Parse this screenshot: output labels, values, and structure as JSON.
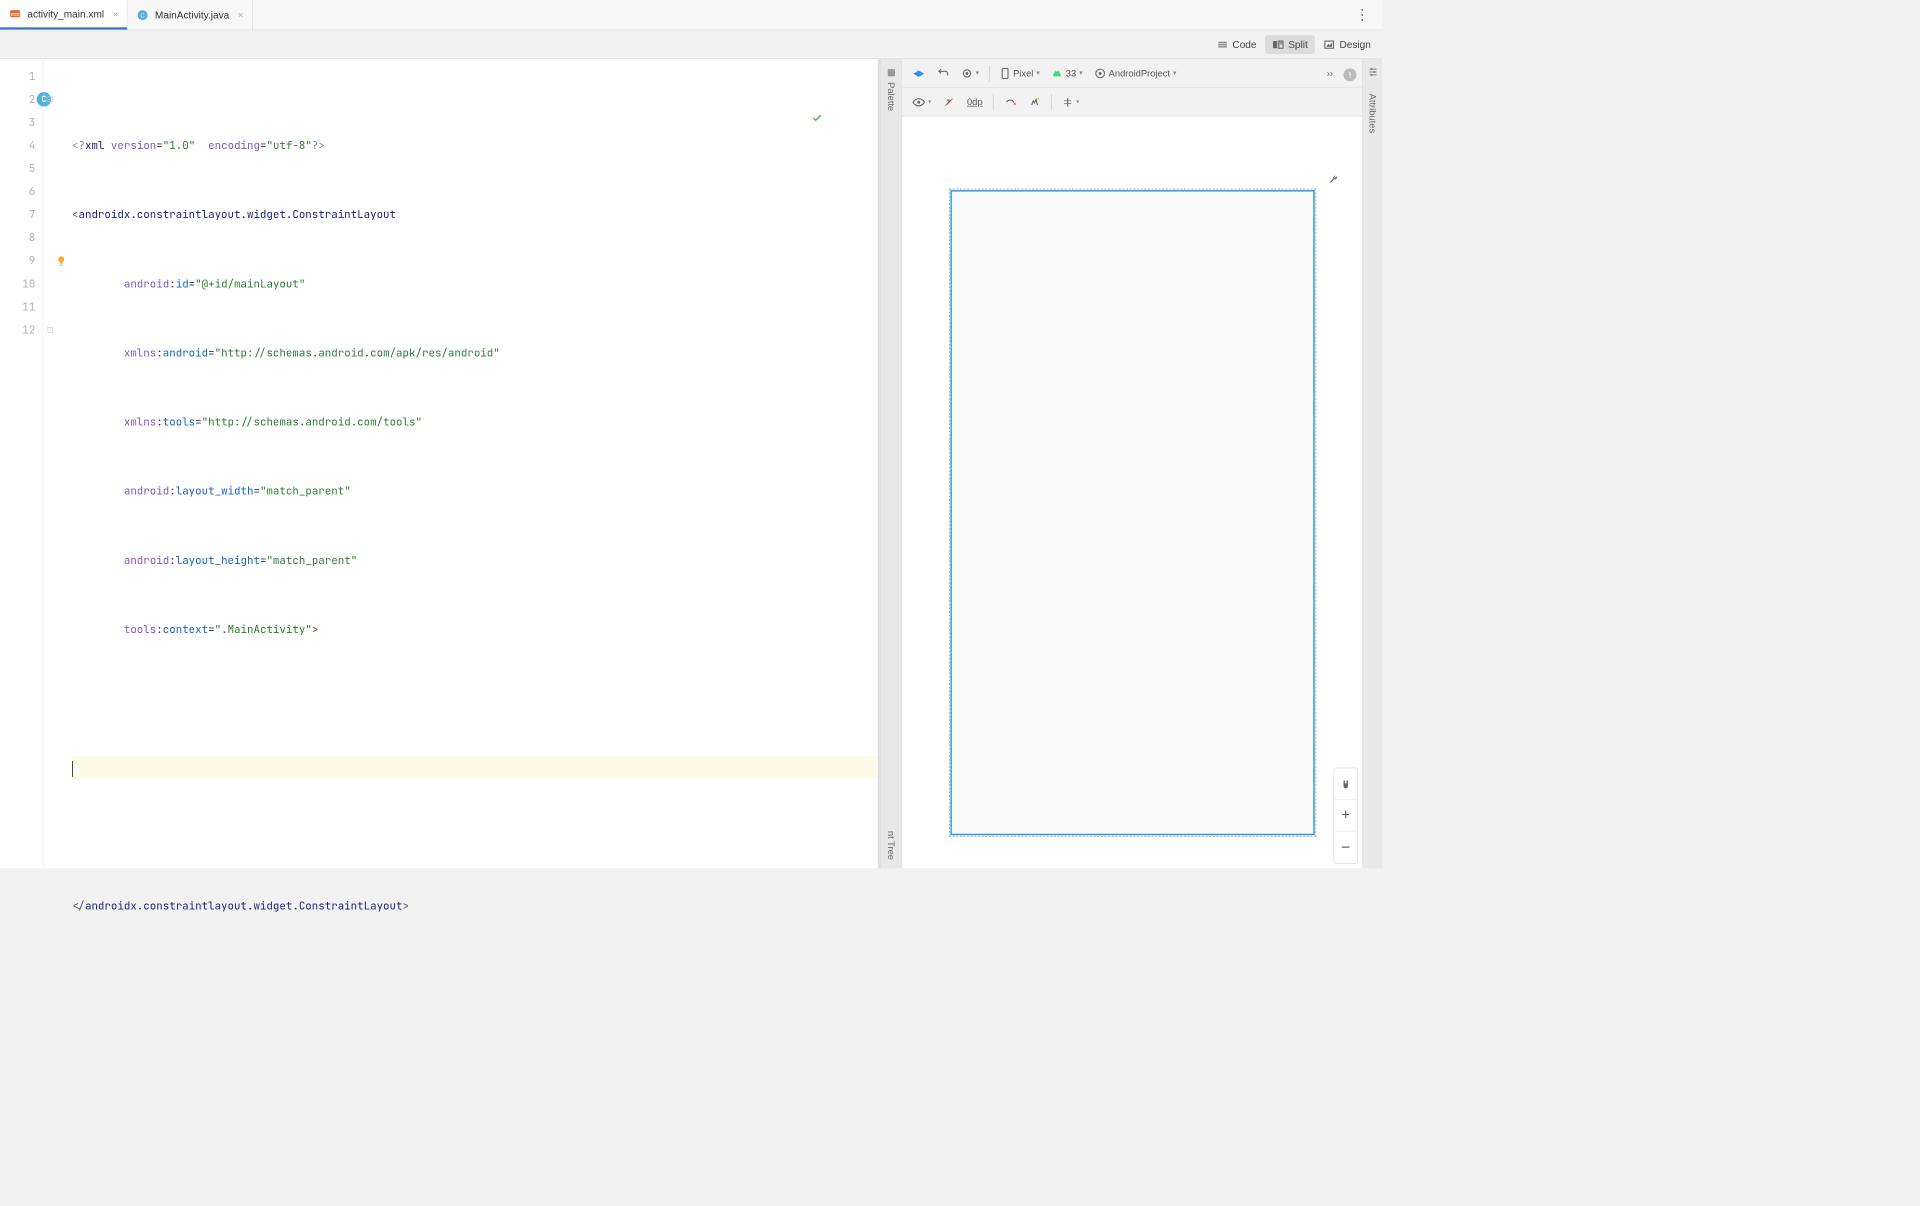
{
  "tabs": [
    {
      "label": "activity_main.xml",
      "active": true,
      "iconColor": "#e26a2c"
    },
    {
      "label": "MainActivity.java",
      "active": false,
      "iconColor": "#50b0e0"
    }
  ],
  "viewModes": {
    "code": "Code",
    "split": "Split",
    "design": "Design"
  },
  "code": {
    "lines": [
      1,
      2,
      3,
      4,
      5,
      6,
      7,
      8,
      9,
      10,
      11,
      12
    ],
    "l1": {
      "pre": "<?",
      "kw": "xml",
      "sp": " ",
      "a1": "version",
      "eq": "=",
      "v1": "\"1.0\"",
      "sp2": "  ",
      "a2": "encoding",
      "eq2": "=",
      "v2": "\"utf-8\"",
      "post": "?>"
    },
    "l2": {
      "open": "<",
      "tag": "androidx.constraintlayout.widget.ConstraintLayout"
    },
    "l3": {
      "ns": "android",
      "colon": ":",
      "attr": "id",
      "eq": "=",
      "val": "\"@+id/mainLayout\""
    },
    "l4": {
      "ns": "xmlns",
      "colon": ":",
      "attr": "android",
      "eq": "=",
      "val": "\"http://schemas.android.com/apk/res/android\""
    },
    "l5": {
      "ns": "xmlns",
      "colon": ":",
      "attr": "tools",
      "eq": "=",
      "val": "\"http://schemas.android.com/tools\""
    },
    "l6": {
      "ns": "android",
      "colon": ":",
      "attr": "layout_width",
      "eq": "=",
      "val": "\"match_parent\""
    },
    "l7": {
      "ns": "android",
      "colon": ":",
      "attr": "layout_height",
      "eq": "=",
      "val": "\"match_parent\""
    },
    "l8": {
      "ns": "tools",
      "colon": ":",
      "attr": "context",
      "eq": "=",
      "val": "\".MainActivity\"",
      "close": ">"
    },
    "l12": {
      "open": "</",
      "tag": "androidx.constraintlayout.widget.ConstraintLayout",
      "close": ">"
    },
    "gutterBadge": "C"
  },
  "sideTabs": {
    "palette": "Palette",
    "componentTree": "nt Tree"
  },
  "previewToolbar": {
    "device": "Pixel",
    "api": "33",
    "project": "AndroidProject",
    "overflow": "››"
  },
  "previewToolbar2": {
    "overrideWidth": "0dp"
  },
  "rightStrip": {
    "attributes": "Attributes",
    "warning": "!"
  }
}
